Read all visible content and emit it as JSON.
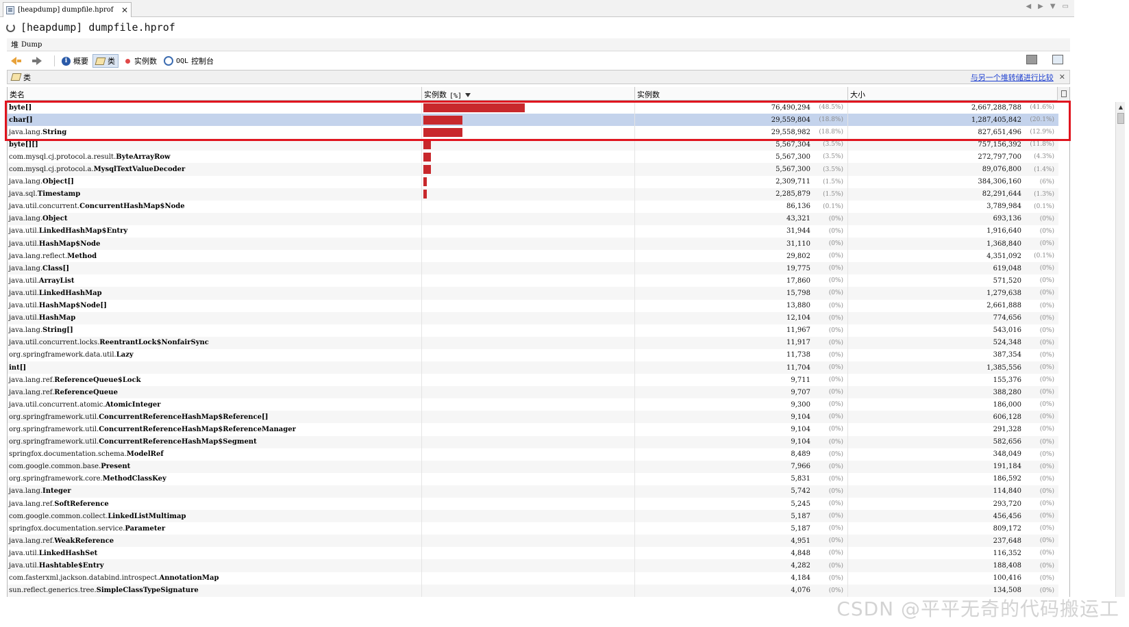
{
  "tab": {
    "label": "[heapdump] dumpfile.hprof",
    "close": "✕"
  },
  "title": "[heapdump] dumpfile.hprof",
  "heap_tab": {
    "label_cn": "堆",
    "label": "Dump"
  },
  "toolbar": {
    "summary": "概要",
    "classes": "类",
    "instances": "实例数",
    "oql_prefix": "OQL",
    "oql_console": "控制台"
  },
  "class_panel": {
    "title": "类",
    "compare_link": "与另一个堆转储进行比较",
    "close": "✕"
  },
  "columns": {
    "name": "类名",
    "instances_pct": "实例数",
    "instances_pct_suffix": "[%]",
    "instances": "实例数",
    "size": "大小"
  },
  "rows": [
    {
      "pkg": "",
      "cls": "byte[]",
      "bar": 48.5,
      "count": "76,490,294",
      "count_pct": "(48.5%)",
      "size": "2,667,288,788",
      "size_pct": "(41.6%)"
    },
    {
      "pkg": "",
      "cls": "char[]",
      "bar": 18.8,
      "count": "29,559,804",
      "count_pct": "(18.8%)",
      "size": "1,287,405,842",
      "size_pct": "(20.1%)"
    },
    {
      "pkg": "java.lang.",
      "cls": "String",
      "bar": 18.8,
      "count": "29,558,982",
      "count_pct": "(18.8%)",
      "size": "827,651,496",
      "size_pct": "(12.9%)"
    },
    {
      "pkg": "",
      "cls": "byte[][]",
      "bar": 3.5,
      "count": "5,567,304",
      "count_pct": "(3.5%)",
      "size": "757,156,392",
      "size_pct": "(11.8%)"
    },
    {
      "pkg": "com.mysql.cj.protocol.a.result.",
      "cls": "ByteArrayRow",
      "bar": 3.5,
      "count": "5,567,300",
      "count_pct": "(3.5%)",
      "size": "272,797,700",
      "size_pct": "(4.3%)"
    },
    {
      "pkg": "com.mysql.cj.protocol.a.",
      "cls": "MysqlTextValueDecoder",
      "bar": 3.5,
      "count": "5,567,300",
      "count_pct": "(3.5%)",
      "size": "89,076,800",
      "size_pct": "(1.4%)"
    },
    {
      "pkg": "java.lang.",
      "cls": "Object[]",
      "bar": 1.5,
      "count": "2,309,711",
      "count_pct": "(1.5%)",
      "size": "384,306,160",
      "size_pct": "(6%)"
    },
    {
      "pkg": "java.sql.",
      "cls": "Timestamp",
      "bar": 1.5,
      "count": "2,285,879",
      "count_pct": "(1.5%)",
      "size": "82,291,644",
      "size_pct": "(1.3%)"
    },
    {
      "pkg": "java.util.concurrent.",
      "cls": "ConcurrentHashMap$Node",
      "bar": 0.1,
      "count": "86,136",
      "count_pct": "(0.1%)",
      "size": "3,789,984",
      "size_pct": "(0.1%)"
    },
    {
      "pkg": "java.lang.",
      "cls": "Object",
      "bar": 0,
      "count": "43,321",
      "count_pct": "(0%)",
      "size": "693,136",
      "size_pct": "(0%)"
    },
    {
      "pkg": "java.util.",
      "cls": "LinkedHashMap$Entry",
      "bar": 0,
      "count": "31,944",
      "count_pct": "(0%)",
      "size": "1,916,640",
      "size_pct": "(0%)"
    },
    {
      "pkg": "java.util.",
      "cls": "HashMap$Node",
      "bar": 0,
      "count": "31,110",
      "count_pct": "(0%)",
      "size": "1,368,840",
      "size_pct": "(0%)"
    },
    {
      "pkg": "java.lang.reflect.",
      "cls": "Method",
      "bar": 0,
      "count": "29,802",
      "count_pct": "(0%)",
      "size": "4,351,092",
      "size_pct": "(0.1%)"
    },
    {
      "pkg": "java.lang.",
      "cls": "Class[]",
      "bar": 0,
      "count": "19,775",
      "count_pct": "(0%)",
      "size": "619,048",
      "size_pct": "(0%)"
    },
    {
      "pkg": "java.util.",
      "cls": "ArrayList",
      "bar": 0,
      "count": "17,860",
      "count_pct": "(0%)",
      "size": "571,520",
      "size_pct": "(0%)"
    },
    {
      "pkg": "java.util.",
      "cls": "LinkedHashMap",
      "bar": 0,
      "count": "15,798",
      "count_pct": "(0%)",
      "size": "1,279,638",
      "size_pct": "(0%)"
    },
    {
      "pkg": "java.util.",
      "cls": "HashMap$Node[]",
      "bar": 0,
      "count": "13,880",
      "count_pct": "(0%)",
      "size": "2,661,888",
      "size_pct": "(0%)"
    },
    {
      "pkg": "java.util.",
      "cls": "HashMap",
      "bar": 0,
      "count": "12,104",
      "count_pct": "(0%)",
      "size": "774,656",
      "size_pct": "(0%)"
    },
    {
      "pkg": "java.lang.",
      "cls": "String[]",
      "bar": 0,
      "count": "11,967",
      "count_pct": "(0%)",
      "size": "543,016",
      "size_pct": "(0%)"
    },
    {
      "pkg": "java.util.concurrent.locks.",
      "cls": "ReentrantLock$NonfairSync",
      "bar": 0,
      "count": "11,917",
      "count_pct": "(0%)",
      "size": "524,348",
      "size_pct": "(0%)"
    },
    {
      "pkg": "org.springframework.data.util.",
      "cls": "Lazy",
      "bar": 0,
      "count": "11,738",
      "count_pct": "(0%)",
      "size": "387,354",
      "size_pct": "(0%)"
    },
    {
      "pkg": "",
      "cls": "int[]",
      "bar": 0,
      "count": "11,704",
      "count_pct": "(0%)",
      "size": "1,385,556",
      "size_pct": "(0%)"
    },
    {
      "pkg": "java.lang.ref.",
      "cls": "ReferenceQueue$Lock",
      "bar": 0,
      "count": "9,711",
      "count_pct": "(0%)",
      "size": "155,376",
      "size_pct": "(0%)"
    },
    {
      "pkg": "java.lang.ref.",
      "cls": "ReferenceQueue",
      "bar": 0,
      "count": "9,707",
      "count_pct": "(0%)",
      "size": "388,280",
      "size_pct": "(0%)"
    },
    {
      "pkg": "java.util.concurrent.atomic.",
      "cls": "AtomicInteger",
      "bar": 0,
      "count": "9,300",
      "count_pct": "(0%)",
      "size": "186,000",
      "size_pct": "(0%)"
    },
    {
      "pkg": "org.springframework.util.",
      "cls": "ConcurrentReferenceHashMap$Reference[]",
      "bar": 0,
      "count": "9,104",
      "count_pct": "(0%)",
      "size": "606,128",
      "size_pct": "(0%)"
    },
    {
      "pkg": "org.springframework.util.",
      "cls": "ConcurrentReferenceHashMap$ReferenceManager",
      "bar": 0,
      "count": "9,104",
      "count_pct": "(0%)",
      "size": "291,328",
      "size_pct": "(0%)"
    },
    {
      "pkg": "org.springframework.util.",
      "cls": "ConcurrentReferenceHashMap$Segment",
      "bar": 0,
      "count": "9,104",
      "count_pct": "(0%)",
      "size": "582,656",
      "size_pct": "(0%)"
    },
    {
      "pkg": "springfox.documentation.schema.",
      "cls": "ModelRef",
      "bar": 0,
      "count": "8,489",
      "count_pct": "(0%)",
      "size": "348,049",
      "size_pct": "(0%)"
    },
    {
      "pkg": "com.google.common.base.",
      "cls": "Present",
      "bar": 0,
      "count": "7,966",
      "count_pct": "(0%)",
      "size": "191,184",
      "size_pct": "(0%)"
    },
    {
      "pkg": "org.springframework.core.",
      "cls": "MethodClassKey",
      "bar": 0,
      "count": "5,831",
      "count_pct": "(0%)",
      "size": "186,592",
      "size_pct": "(0%)"
    },
    {
      "pkg": "java.lang.",
      "cls": "Integer",
      "bar": 0,
      "count": "5,742",
      "count_pct": "(0%)",
      "size": "114,840",
      "size_pct": "(0%)"
    },
    {
      "pkg": "java.lang.ref.",
      "cls": "SoftReference",
      "bar": 0,
      "count": "5,245",
      "count_pct": "(0%)",
      "size": "293,720",
      "size_pct": "(0%)"
    },
    {
      "pkg": "com.google.common.collect.",
      "cls": "LinkedListMultimap",
      "bar": 0,
      "count": "5,187",
      "count_pct": "(0%)",
      "size": "456,456",
      "size_pct": "(0%)"
    },
    {
      "pkg": "springfox.documentation.service.",
      "cls": "Parameter",
      "bar": 0,
      "count": "5,187",
      "count_pct": "(0%)",
      "size": "809,172",
      "size_pct": "(0%)"
    },
    {
      "pkg": "java.lang.ref.",
      "cls": "WeakReference",
      "bar": 0,
      "count": "4,951",
      "count_pct": "(0%)",
      "size": "237,648",
      "size_pct": "(0%)"
    },
    {
      "pkg": "java.util.",
      "cls": "LinkedHashSet",
      "bar": 0,
      "count": "4,848",
      "count_pct": "(0%)",
      "size": "116,352",
      "size_pct": "(0%)"
    },
    {
      "pkg": "java.util.",
      "cls": "Hashtable$Entry",
      "bar": 0,
      "count": "4,282",
      "count_pct": "(0%)",
      "size": "188,408",
      "size_pct": "(0%)"
    },
    {
      "pkg": "com.fasterxml.jackson.databind.introspect.",
      "cls": "AnnotationMap",
      "bar": 0,
      "count": "4,184",
      "count_pct": "(0%)",
      "size": "100,416",
      "size_pct": "(0%)"
    },
    {
      "pkg": "sun.reflect.generics.tree.",
      "cls": "SimpleClassTypeSignature",
      "bar": 0,
      "count": "4,076",
      "count_pct": "(0%)",
      "size": "134,508",
      "size_pct": "(0%)"
    }
  ],
  "selected_row": 1,
  "colors": {
    "bar": "#c8282c",
    "highlight": "#e0141e",
    "selected": "#c4d3ec",
    "link": "#1d3fd0"
  },
  "watermark": "CSDN @平平无奇的代码搬运工"
}
